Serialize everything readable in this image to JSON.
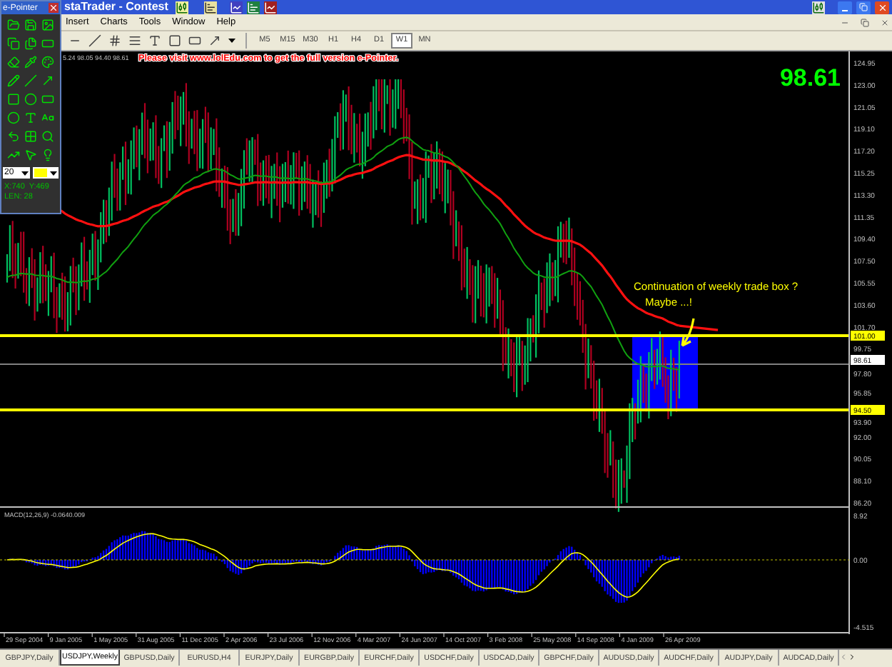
{
  "window": {
    "title": "staTrader - Contest"
  },
  "menu": [
    "Insert",
    "Charts",
    "Tools",
    "Window",
    "Help"
  ],
  "timeframes": [
    {
      "label": "M5",
      "selected": false
    },
    {
      "label": "M15",
      "selected": false
    },
    {
      "label": "M30",
      "selected": false
    },
    {
      "label": "H1",
      "selected": false
    },
    {
      "label": "H4",
      "selected": false
    },
    {
      "label": "D1",
      "selected": false
    },
    {
      "label": "W1",
      "selected": true
    },
    {
      "label": "MN",
      "selected": false
    }
  ],
  "chart": {
    "banner": "Please visit www.lolEdu.com to get the full version e-Pointer.",
    "ohlc": "5.24 98.05 94.40 98.61",
    "last_price": "98.61",
    "price_ticks": [
      "124.95",
      "123.00",
      "121.05",
      "119.10",
      "117.20",
      "115.25",
      "113.30",
      "111.35",
      "109.40",
      "107.50",
      "105.55",
      "103.60",
      "101.70",
      "99.75",
      "97.80",
      "95.85",
      "93.90",
      "92.00",
      "90.05",
      "88.10",
      "86.20"
    ],
    "levels": [
      {
        "label": "101.00",
        "color": "#ffff00"
      },
      {
        "label": "98.61",
        "color": "#ffffff"
      },
      {
        "label": "94.50",
        "color": "#ffff00"
      }
    ],
    "annotation": [
      "Continuation of weekly trade box ?",
      "Maybe ...!"
    ],
    "macd": {
      "label": "MACD(12,26,9) -0.0640.009",
      "ticks": [
        "8.92",
        "0.00",
        "-4.515"
      ]
    },
    "dates": [
      "29 Sep 2004",
      "9 Jan 2005",
      "1 May 2005",
      "31 Aug 2005",
      "11 Dec 2005",
      "2 Apr 2006",
      "23 Jul 2006",
      "12 Nov 2006",
      "4 Mar 2007",
      "24 Jun 2007",
      "14 Oct 2007",
      "3 Feb 2008",
      "25 May 2008",
      "14 Sep 2008",
      "4 Jan 2009",
      "26 Apr 2009"
    ]
  },
  "tabs": [
    {
      "label": "GBPJPY,Daily",
      "selected": false
    },
    {
      "label": "USDJPY,Weekly",
      "selected": true
    },
    {
      "label": "GBPUSD,Daily",
      "selected": false
    },
    {
      "label": "EURUSD,H4",
      "selected": false
    },
    {
      "label": "EURJPY,Daily",
      "selected": false
    },
    {
      "label": "EURGBP,Daily",
      "selected": false
    },
    {
      "label": "EURCHF,Daily",
      "selected": false
    },
    {
      "label": "USDCHF,Daily",
      "selected": false
    },
    {
      "label": "USDCAD,Daily",
      "selected": false
    },
    {
      "label": "GBPCHF,Daily",
      "selected": false
    },
    {
      "label": "AUDUSD,Daily",
      "selected": false
    },
    {
      "label": "AUDCHF,Daily",
      "selected": false
    },
    {
      "label": "AUDJPY,Daily",
      "selected": false
    },
    {
      "label": "AUDCAD,Daily",
      "selected": false
    }
  ],
  "e_pointer": {
    "title": "e-Pointer",
    "size": "20",
    "color": "#ffff00",
    "coords": "X:740  Y:469",
    "length": "LEN: 28"
  }
}
